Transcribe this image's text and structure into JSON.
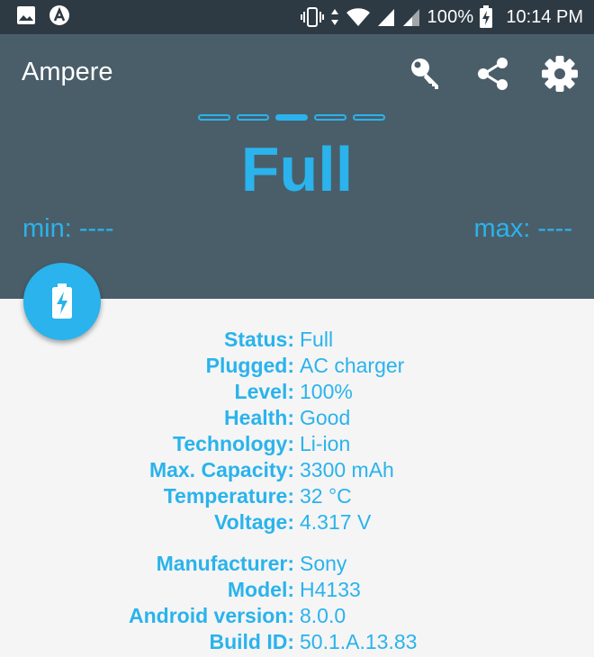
{
  "status_bar": {
    "battery_percent": "100%",
    "time": "10:14 PM"
  },
  "app_bar": {
    "title": "Ampere",
    "icons": [
      "key-icon",
      "share-icon",
      "settings-gear-icon"
    ]
  },
  "pager": {
    "count": 5,
    "active_index": 2
  },
  "battery": {
    "status_big": "Full",
    "min_label": "min: ----",
    "max_label": "max: ----"
  },
  "info": {
    "status": {
      "key": "Status:",
      "value": "Full"
    },
    "plugged": {
      "key": "Plugged:",
      "value": "AC charger"
    },
    "level": {
      "key": "Level:",
      "value": "100%"
    },
    "health": {
      "key": "Health:",
      "value": "Good"
    },
    "technology": {
      "key": "Technology:",
      "value": "Li-ion"
    },
    "max_capacity": {
      "key": "Max. Capacity:",
      "value": "3300 mAh"
    },
    "temperature": {
      "key": "Temperature:",
      "value": "32 °C"
    },
    "voltage": {
      "key": "Voltage:",
      "value": "4.317 V"
    },
    "manufacturer": {
      "key": "Manufacturer:",
      "value": "Sony"
    },
    "model": {
      "key": "Model:",
      "value": "H4133"
    },
    "android_version": {
      "key": "Android version:",
      "value": "8.0.0"
    },
    "build_id": {
      "key": "Build ID:",
      "value": "50.1.A.13.83"
    }
  },
  "colors": {
    "accent": "#2ab3ec",
    "app_bar": "#4a5e6a",
    "status_bar": "#2d3a43",
    "background": "#f5f5f5"
  }
}
